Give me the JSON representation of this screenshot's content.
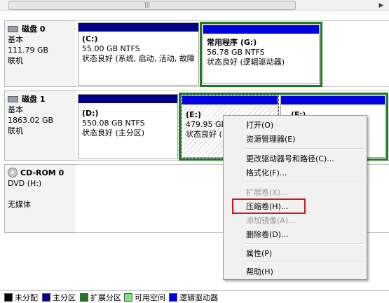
{
  "colors": {
    "unallocated": "#000000",
    "primary": "#00008b",
    "extended": "#1f7a1f",
    "free": "#7ee27e",
    "logical": "#0000e0",
    "highlight": "#d0141f"
  },
  "scrollbar": {
    "grip": "|||"
  },
  "disks": [
    {
      "title": "磁盘 0",
      "type": "基本",
      "size": "111.79 GB",
      "status": "联机",
      "partitions": [
        {
          "name": "(C:)",
          "size": "55.00 GB NTFS",
          "status": "状态良好 (系统, 启动, 活动, 故障"
        },
        {
          "name": "常用程序 (G:)",
          "size": "56.78 GB NTFS",
          "status": "状态良好 (逻辑驱动器)"
        }
      ]
    },
    {
      "title": "磁盘 1",
      "type": "基本",
      "size": "1863.02 GB",
      "status": "联机",
      "partitions": [
        {
          "name": "(D:)",
          "size": "550.08 GB NTFS",
          "status": "状态良好 (主分区)"
        },
        {
          "name": "(E:)",
          "size": "479.95 GB",
          "status": "状态良好 ("
        },
        {
          "name": "(F:)",
          "size": "",
          "status": ""
        }
      ]
    },
    {
      "title": "CD-ROM 0",
      "type": "DVD (H:)",
      "size": "",
      "status": "无媒体"
    }
  ],
  "context_menu": {
    "items": [
      {
        "label": "打开(O)",
        "enabled": true
      },
      {
        "label": "资源管理器(E)",
        "enabled": true
      },
      {
        "label": "更改驱动器号和路径(C)...",
        "enabled": true
      },
      {
        "label": "格式化(F)...",
        "enabled": true
      },
      {
        "label": "扩展卷(X)...",
        "enabled": false
      },
      {
        "label": "压缩卷(H)...",
        "enabled": true
      },
      {
        "label": "添加镜像(A)...",
        "enabled": false
      },
      {
        "label": "删除卷(D)...",
        "enabled": true
      },
      {
        "label": "属性(P)",
        "enabled": true
      },
      {
        "label": "帮助(H)",
        "enabled": true
      }
    ]
  },
  "legend": [
    {
      "label": "未分配",
      "color": "#000000"
    },
    {
      "label": "主分区",
      "color": "#00008b"
    },
    {
      "label": "扩展分区",
      "color": "#1f7a1f"
    },
    {
      "label": "可用空间",
      "color": "#7ee27e"
    },
    {
      "label": "逻辑驱动器",
      "color": "#0000e0"
    }
  ]
}
